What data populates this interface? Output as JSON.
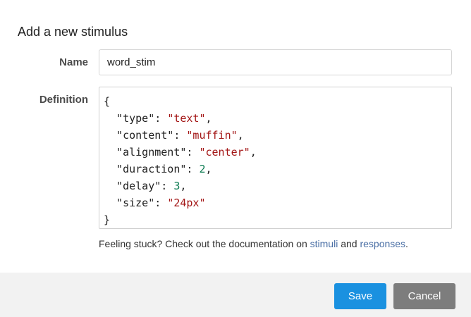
{
  "dialog": {
    "title": "Add a new stimulus"
  },
  "form": {
    "name_label": "Name",
    "name_value": "word_stim",
    "definition_label": "Definition",
    "definition_lines": [
      [
        {
          "t": "p",
          "v": "{"
        }
      ],
      [
        {
          "t": "p",
          "v": "  \"type\": "
        },
        {
          "t": "s",
          "v": "\"text\""
        },
        {
          "t": "p",
          "v": ","
        }
      ],
      [
        {
          "t": "p",
          "v": "  \"content\": "
        },
        {
          "t": "s",
          "v": "\"muffin\""
        },
        {
          "t": "p",
          "v": ","
        }
      ],
      [
        {
          "t": "p",
          "v": "  \"alignment\": "
        },
        {
          "t": "s",
          "v": "\"center\""
        },
        {
          "t": "p",
          "v": ","
        }
      ],
      [
        {
          "t": "p",
          "v": "  \"duraction\": "
        },
        {
          "t": "n",
          "v": "2"
        },
        {
          "t": "p",
          "v": ","
        }
      ],
      [
        {
          "t": "p",
          "v": "  \"delay\": "
        },
        {
          "t": "n",
          "v": "3"
        },
        {
          "t": "p",
          "v": ","
        }
      ],
      [
        {
          "t": "p",
          "v": "  \"size\": "
        },
        {
          "t": "s",
          "v": "\"24px\""
        }
      ],
      [
        {
          "t": "p",
          "v": "}"
        }
      ]
    ]
  },
  "help": {
    "prefix": "Feeling stuck? Check out the documentation on ",
    "link_stimuli": "stimuli",
    "middle": " and ",
    "link_responses": "responses",
    "suffix": "."
  },
  "footer": {
    "save_label": "Save",
    "cancel_label": "Cancel"
  },
  "colors": {
    "primary_button": "#1a91e0",
    "secondary_button": "#7d7d7d",
    "link": "#4a6fa5",
    "code_string": "#a31515",
    "code_number": "#0a7a50",
    "footer_bg": "#f2f2f2"
  }
}
